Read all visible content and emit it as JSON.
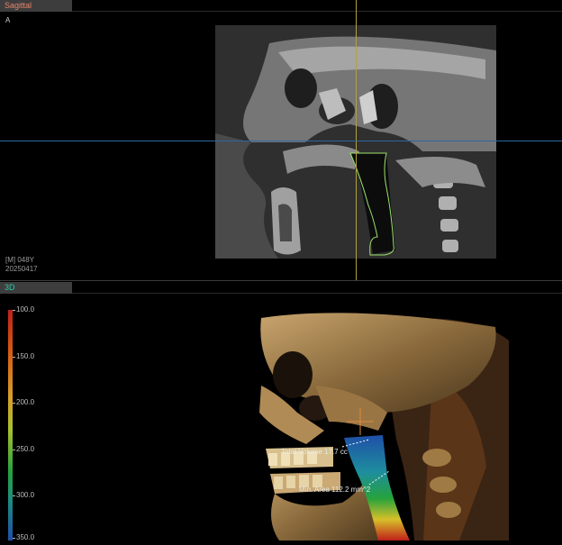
{
  "sagittal": {
    "title": "Sagittal",
    "orientation": "A",
    "patient": "[M] 048Y",
    "date": "20250417"
  },
  "view3d": {
    "title": "3D",
    "colorbar": {
      "labels": [
        "100.0",
        "150.0",
        "200.0",
        "250.0",
        "300.0",
        "350.0"
      ],
      "colors": [
        "#c0201a",
        "#d55a14",
        "#d7a02a",
        "#a8c02e",
        "#26a23c",
        "#1e8e7e",
        "#1f4fa8"
      ]
    },
    "annotations": {
      "total_volume": "Total Volume 17.7 cc",
      "min_area": "Min. Area 112.2 mm^2"
    }
  },
  "colors": {
    "crosshair_vertical": "#b3a23d",
    "crosshair_horizontal": "#2e67a3",
    "airway_outline": "#9be36a"
  }
}
